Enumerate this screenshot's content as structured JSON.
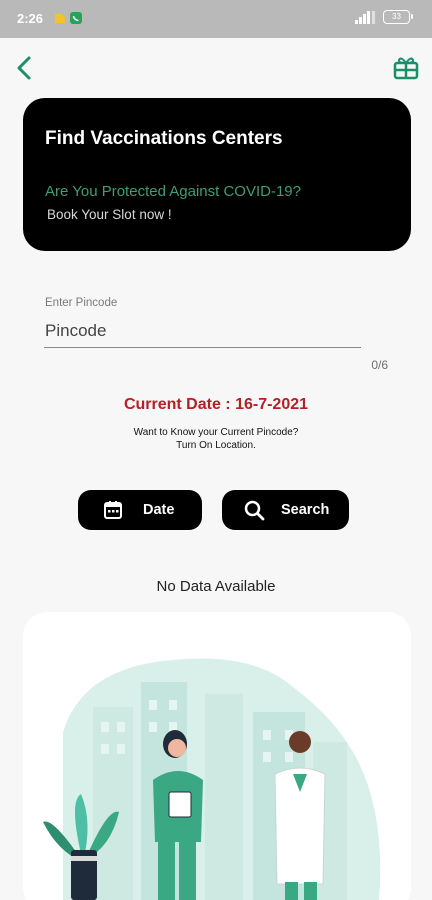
{
  "status_bar": {
    "time": "2:26",
    "battery": "33"
  },
  "header": {
    "back_icon": "chevron-left-icon",
    "gift_icon": "gift-box-icon"
  },
  "hero": {
    "title": "Find Vaccinations Centers",
    "question": "Are You Protected Against COVID-19?",
    "cta": "Book Your Slot now !"
  },
  "pincode": {
    "label": "Enter Pincode",
    "placeholder": "Pincode",
    "value": "",
    "counter": "0/6"
  },
  "current_date": "Current Date : 16-7-2021",
  "location_hint": {
    "line1": "Want to Know your Current Pincode?",
    "line2": "Turn On Location."
  },
  "buttons": {
    "date_label": "Date",
    "search_label": "Search"
  },
  "empty_state": "No Data Available",
  "colors": {
    "accent": "#1a8f6a",
    "card": "#000000",
    "date_red": "#b32025",
    "illustration_teal": "#4cbfa6"
  }
}
